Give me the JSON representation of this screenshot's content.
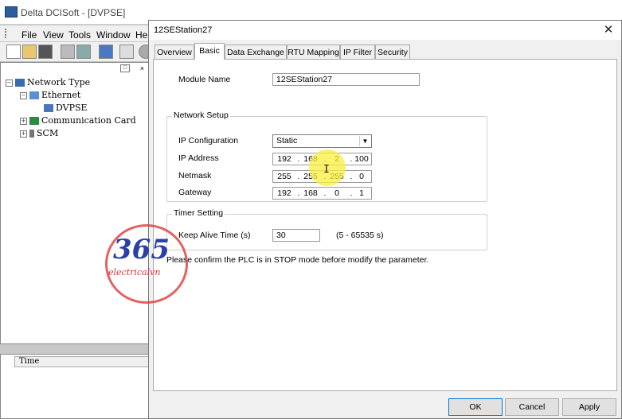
{
  "app": {
    "title": "Delta DCISoft - [DVPSE]",
    "menu": [
      "File",
      "View",
      "Tools",
      "Window",
      "Hel"
    ]
  },
  "tree": {
    "root": "Network Type",
    "ethernet": "Ethernet",
    "dvpse": "DVPSE",
    "comm_card": "Communication Card",
    "scm": "SCM"
  },
  "log": {
    "time_header": "Time"
  },
  "dialog": {
    "title": "12SEStation27",
    "close_glyph": "✕",
    "tabs": [
      "Overview",
      "Basic",
      "Data Exchange",
      "RTU Mapping",
      "IP Filter",
      "Security"
    ],
    "active_tab": "Basic",
    "module_name_label": "Module Name",
    "module_name_value": "12SEStation27",
    "network_setup": {
      "title": "Network Setup",
      "ip_config_label": "IP Configuration",
      "ip_config_value": "Static",
      "ip_address_label": "IP Address",
      "ip_address": [
        "192",
        "168",
        "2",
        "100"
      ],
      "netmask_label": "Netmask",
      "netmask": [
        "255",
        "255",
        "255",
        "0"
      ],
      "gateway_label": "Gateway",
      "gateway": [
        "192",
        "168",
        "0",
        "1"
      ]
    },
    "timer": {
      "title": "Timer Setting",
      "keep_alive_label": "Keep Alive Time (s)",
      "keep_alive_value": "30",
      "range_text": "(5 - 65535 s)"
    },
    "warning_text": "Please confirm the PLC is in STOP mode before modify the parameter.",
    "buttons": {
      "ok": "OK",
      "cancel": "Cancel",
      "apply": "Apply"
    }
  },
  "watermark": {
    "number": "365",
    "subtitle": "electricalvn"
  },
  "colors": {
    "highlight": "#faee3c",
    "watermark_ring": "#dc3c3c",
    "watermark_text": "#2b3fa8"
  }
}
